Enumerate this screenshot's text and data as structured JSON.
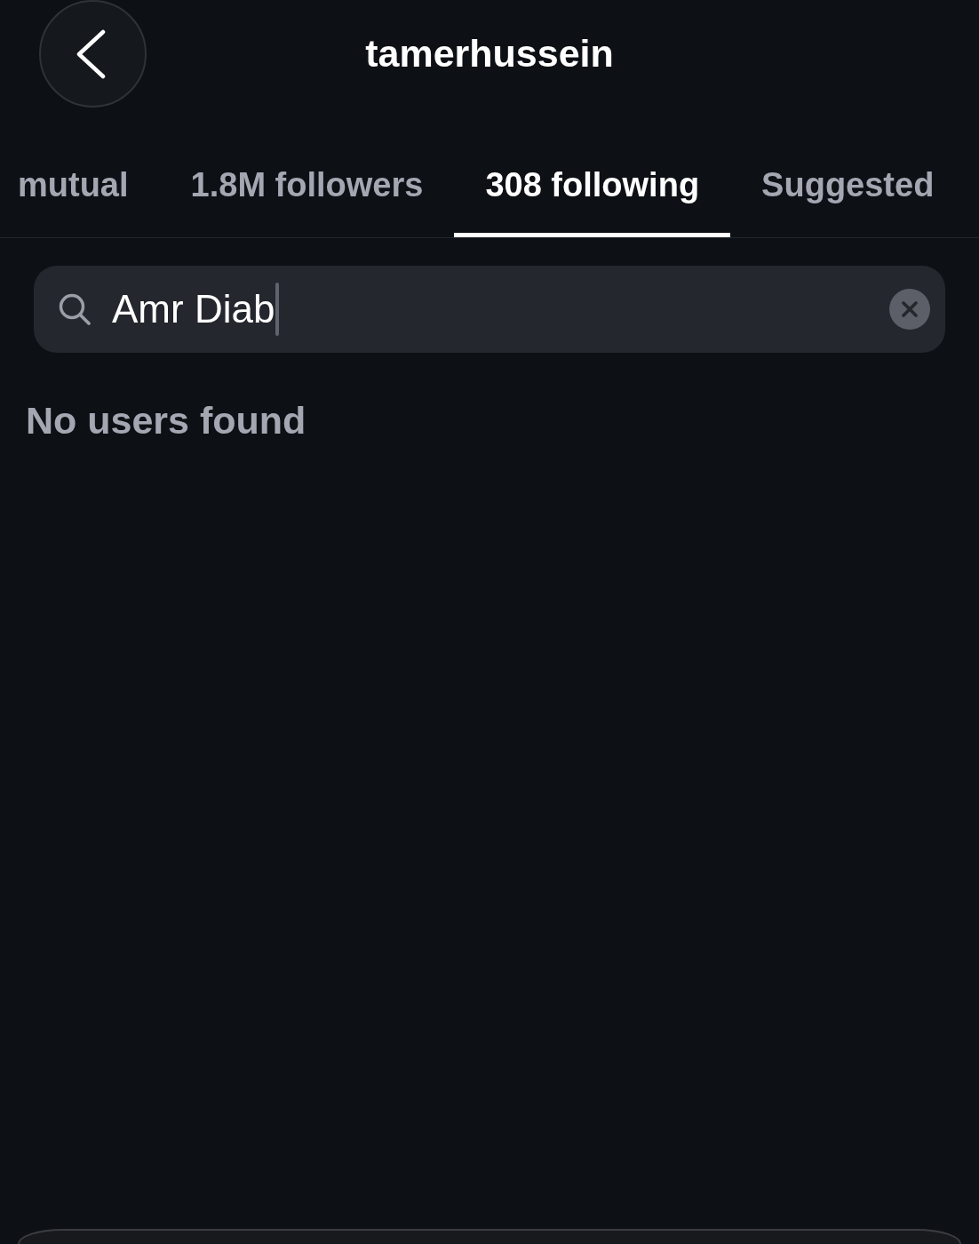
{
  "header": {
    "title": "tamerhussein"
  },
  "tabs": [
    {
      "label": "mutual",
      "selected": false
    },
    {
      "label": "1.8M followers",
      "selected": false
    },
    {
      "label": "308 following",
      "selected": true
    },
    {
      "label": "Suggested",
      "selected": false
    }
  ],
  "search": {
    "value": "Amr Diab",
    "focused": true
  },
  "empty_message": "No users found"
}
